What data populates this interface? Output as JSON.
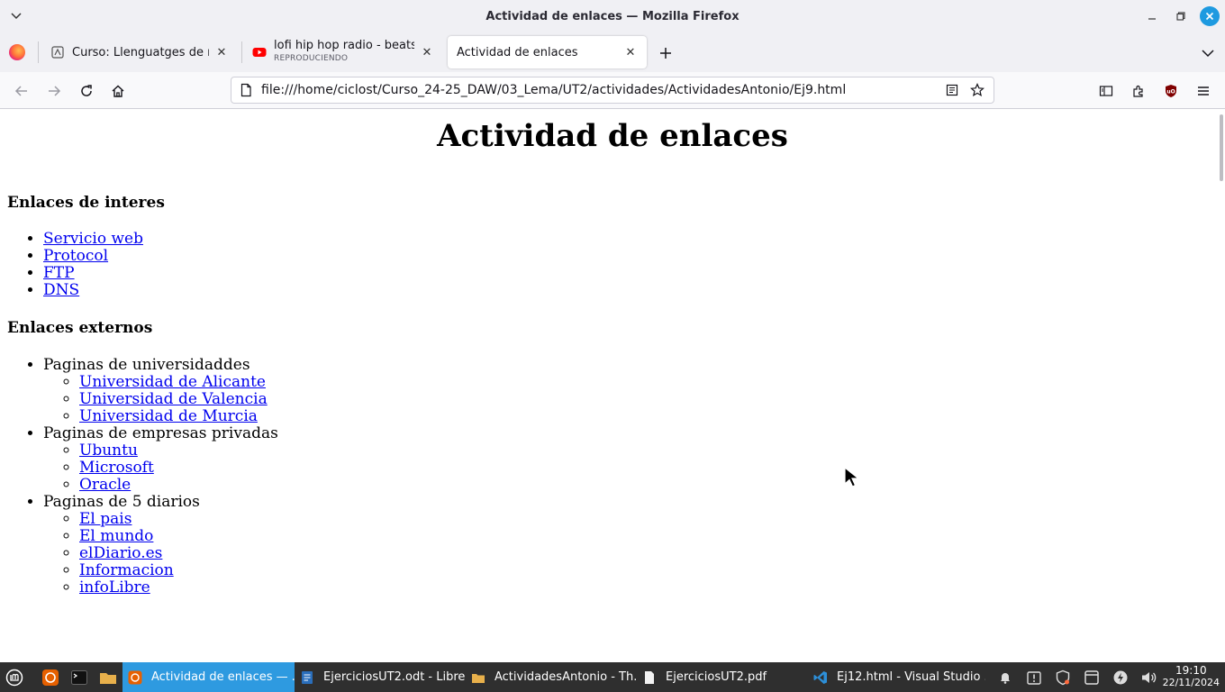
{
  "window": {
    "title": "Actividad de enlaces — Mozilla Firefox"
  },
  "tabs": [
    {
      "label": "Curso: Llenguatges de marc",
      "icon": "moodle-icon",
      "active": false
    },
    {
      "label": "lofi hip hop radio - beats to",
      "sublabel": "REPRODUCIENDO",
      "icon": "youtube-icon",
      "active": false
    },
    {
      "label": "Actividad de enlaces",
      "icon": "",
      "active": true
    }
  ],
  "navbar": {
    "url": "file:///home/ciclost/Curso_24-25_DAW/03_Lema/UT2/actividades/ActividadesAntonio/Ej9.html"
  },
  "page": {
    "heading": "Actividad de enlaces",
    "section1": {
      "title": "Enlaces de interes",
      "links": [
        "Servicio web",
        "Protocol",
        "FTP",
        "DNS"
      ]
    },
    "section2": {
      "title": "Enlaces externos",
      "groups": [
        {
          "label": "Paginas de universidaddes",
          "links": [
            "Universidad de Alicante",
            "Universidad de Valencia",
            "Universidad de Murcia"
          ]
        },
        {
          "label": "Paginas de empresas privadas",
          "links": [
            "Ubuntu",
            "Microsoft",
            "Oracle"
          ]
        },
        {
          "label": "Paginas de 5 diarios",
          "links": [
            "El pais",
            "El mundo",
            "elDiario.es",
            "Informacion",
            "infoLibre"
          ]
        }
      ]
    }
  },
  "taskbar": {
    "items": [
      {
        "label": "Actividad de enlaces — ...",
        "icon": "firefox-icon",
        "active": true
      },
      {
        "label": "EjerciciosUT2.odt - Libre...",
        "icon": "writer-icon",
        "active": false
      },
      {
        "label": "ActividadesAntonio - Th...",
        "icon": "folder-icon",
        "active": false
      },
      {
        "label": "EjerciciosUT2.pdf",
        "icon": "pdf-icon",
        "active": false
      },
      {
        "label": "Ej12.html - Visual Studio ...",
        "icon": "vscode-icon",
        "active": false
      }
    ],
    "clock": {
      "time": "19:10",
      "date": "22/11/2024"
    }
  },
  "colors": {
    "link": "#0000ee",
    "taskbar_bg": "#2f2f2f",
    "taskbar_active": "#2e9ae0",
    "close_button": "#1e9ae0"
  }
}
